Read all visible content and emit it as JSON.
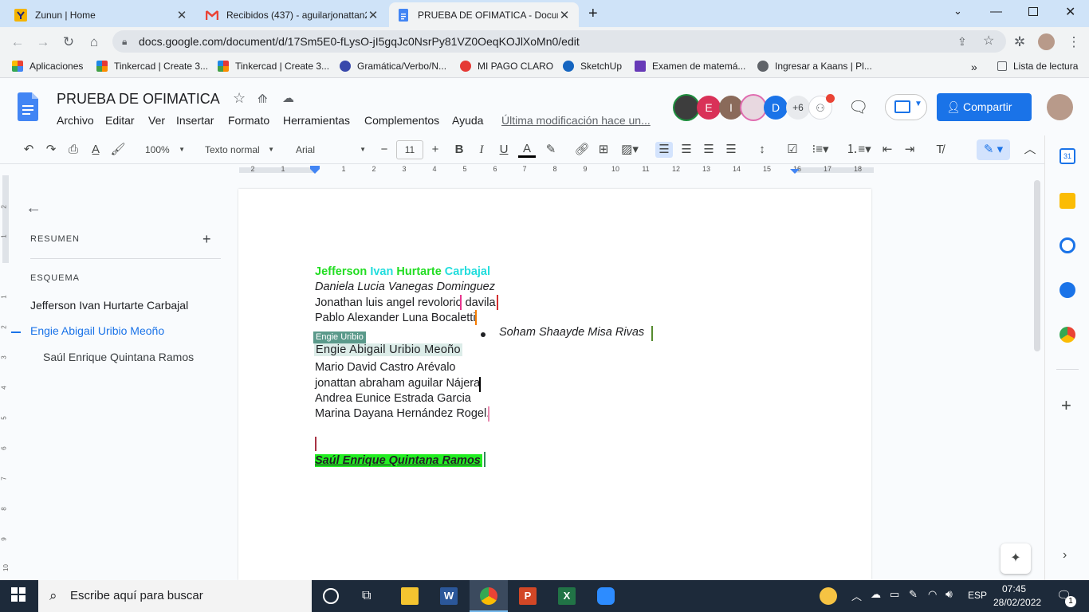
{
  "browser": {
    "tabs": [
      {
        "title": "Zunun | Home",
        "icon": "zunun-icon"
      },
      {
        "title": "Recibidos (437) - aguilarjonattan2",
        "icon": "gmail-icon"
      },
      {
        "title": "PRUEBA DE OFIMATICA - Docum",
        "icon": "docs-icon",
        "active": true
      }
    ],
    "url": "docs.google.com/document/d/17Sm5E0-fLysO-jI5gqJc0NsrPy81VZ0OeqKOJlXoMn0/edit",
    "bookmarks": [
      "Aplicaciones",
      "Tinkercad | Create 3...",
      "Tinkercad | Create 3...",
      "Gramática/Verbo/N...",
      "MI PAGO CLARO",
      "SketchUp",
      "Examen de matemá...",
      "Ingresar a Kaans | Pl..."
    ],
    "reading_list": "Lista de lectura",
    "more_bookmarks": "»"
  },
  "doc": {
    "title": "PRUEBA DE OFIMATICA",
    "menu": [
      "Archivo",
      "Editar",
      "Ver",
      "Insertar",
      "Formato",
      "Herramientas",
      "Complementos",
      "Ayuda"
    ],
    "last_edit": "Última modificación hace un...",
    "share_label": "Compartir",
    "collaborators": [
      {
        "initial": "",
        "color": "#3d3d3d"
      },
      {
        "initial": "E",
        "color": "#d93158"
      },
      {
        "initial": "I",
        "color": "#8a6a5a"
      },
      {
        "initial": "",
        "color": "#e8d8e0"
      },
      {
        "initial": "D",
        "color": "#1a73e8"
      }
    ],
    "more_collaborators": "+6"
  },
  "toolbar": {
    "zoom": "100%",
    "style": "Texto normal",
    "font": "Arial",
    "font_size": "11",
    "minus": "−",
    "plus": "+"
  },
  "ruler": {
    "numbers": [
      "2",
      "1",
      "1",
      "2",
      "3",
      "4",
      "5",
      "6",
      "7",
      "8",
      "9",
      "10",
      "11",
      "12",
      "13",
      "14",
      "15",
      "16",
      "17",
      "18"
    ]
  },
  "vruler": {
    "numbers": [
      "2",
      "1",
      "1",
      "2",
      "3",
      "4",
      "5",
      "6",
      "7",
      "8",
      "9",
      "10"
    ]
  },
  "outline": {
    "summary_label": "RESUMEN",
    "outline_label": "ESQUEMA",
    "items": [
      {
        "text": "Jefferson Ivan Hurtarte Carbajal",
        "level": 1,
        "active": false
      },
      {
        "text": "Engie Abigail Uribio Meoño",
        "level": 1,
        "active": true
      },
      {
        "text": "Saúl Enrique Quintana Ramos",
        "level": 2,
        "active": false
      }
    ]
  },
  "content": {
    "heading_parts": [
      {
        "text": "Jefferson ",
        "color": "#22dd22"
      },
      {
        "text": "Ivan ",
        "color": "#22dddd"
      },
      {
        "text": "Hurtarte ",
        "color": "#22dd22"
      },
      {
        "text": "Carbajal",
        "color": "#22dddd"
      }
    ],
    "lines": [
      "Daniela Lucia Vanegas Dominguez",
      "Jonathan luis angel revolorio davila",
      "Pablo Alexander Luna Bocaletti",
      "Engie Abigail Uribio Meoño",
      "Mario David Castro Arévalo",
      "jonattan abraham aguilar Nájera",
      " Andrea Eunice Estrada Garcia",
      "Marina Dayana Hernández Rogel."
    ],
    "bullet_item": "Soham Shaayde Misa Rivas",
    "cursor_label": "Engie Uribio",
    "last_heading": "Saúl Enrique Quintana Ramos",
    "highlight_color": "#22ee22",
    "cursor_label_color": "#5b9a8b"
  },
  "taskbar": {
    "search_placeholder": "Escribe aquí para buscar",
    "lang": "ESP",
    "time": "07:45",
    "date": "28/02/2022",
    "notif_count": "1"
  }
}
